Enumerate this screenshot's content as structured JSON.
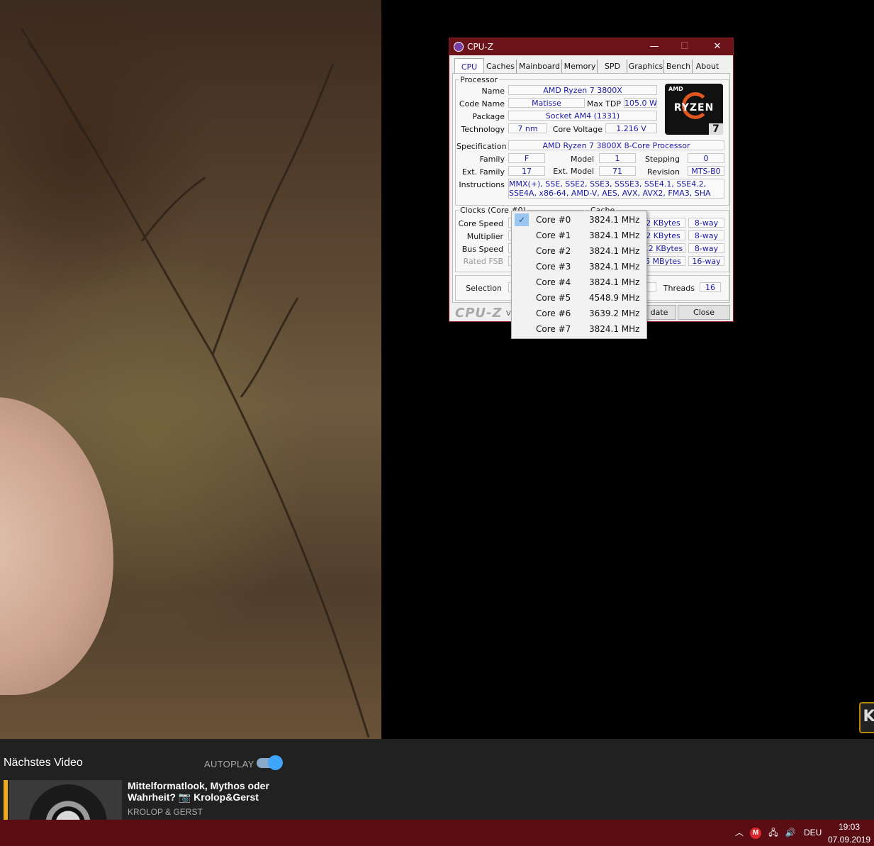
{
  "next_panel": {
    "heading": "Nächstes Video",
    "autoplay_label": "AUTOPLAY",
    "autoplay_on": true,
    "video_title": "Mittelformatlook, Mythos oder Wahrheit? 📷 Krolop&Gerst",
    "channel": "KROLOP & GERST"
  },
  "watermark_text": "K",
  "taskbar": {
    "language": "DEU",
    "time": "19:03",
    "date": "07.09.2019",
    "icons": [
      "chevron-up-icon",
      "mega-icon",
      "network-icon",
      "volume-icon"
    ]
  },
  "cpuz": {
    "title": "CPU-Z",
    "window_buttons": {
      "minimize": "—",
      "maximize": "☐",
      "close": "✕"
    },
    "tabs": [
      "CPU",
      "Caches",
      "Mainboard",
      "Memory",
      "SPD",
      "Graphics",
      "Bench",
      "About"
    ],
    "active_tab": "CPU",
    "processor": {
      "legend": "Processor",
      "name_label": "Name",
      "name": "AMD Ryzen 7 3800X",
      "code_name_label": "Code Name",
      "code_name": "Matisse",
      "max_tdp_label": "Max TDP",
      "max_tdp": "105.0 W",
      "package_label": "Package",
      "package": "Socket AM4 (1331)",
      "technology_label": "Technology",
      "technology": "7 nm",
      "core_voltage_label": "Core Voltage",
      "core_voltage": "1.216 V",
      "specification_label": "Specification",
      "specification": "AMD Ryzen 7 3800X 8-Core Processor",
      "family_label": "Family",
      "family": "F",
      "model_label": "Model",
      "model": "1",
      "stepping_label": "Stepping",
      "stepping": "0",
      "ext_family_label": "Ext. Family",
      "ext_family": "17",
      "ext_model_label": "Ext. Model",
      "ext_model": "71",
      "revision_label": "Revision",
      "revision": "MTS-B0",
      "instructions_label": "Instructions",
      "instructions": "MMX(+), SSE, SSE2, SSE3, SSSE3, SSE4.1, SSE4.2, SSE4A, x86-64, AMD-V, AES, AVX, AVX2, FMA3, SHA"
    },
    "logo": {
      "brand": "AMD",
      "series": "RYZEN",
      "tier": "7"
    },
    "clocks": {
      "legend": "Clocks (Core #0)",
      "core_speed_label": "Core Speed",
      "multiplier_label": "Multiplier",
      "bus_speed_label": "Bus Speed",
      "rated_fsb_label": "Rated FSB"
    },
    "cache": {
      "legend": "Cache",
      "rows": [
        {
          "size": "2 KBytes",
          "assoc": "8-way"
        },
        {
          "size": "2 KBytes",
          "assoc": "8-way"
        },
        {
          "size": "12 KBytes",
          "assoc": "8-way"
        },
        {
          "size": "5 MBytes",
          "assoc": "16-way"
        }
      ]
    },
    "selection_label": "Selection",
    "threads_label": "Threads",
    "threads": "16",
    "footer": {
      "brand": "CPU-Z",
      "version_prefix": "V",
      "validate_label": "date",
      "close_label": "Close"
    }
  },
  "core_dropdown": {
    "items": [
      {
        "core": "Core #0",
        "freq": "3824.1 MHz",
        "checked": true
      },
      {
        "core": "Core #1",
        "freq": "3824.1 MHz",
        "checked": false
      },
      {
        "core": "Core #2",
        "freq": "3824.1 MHz",
        "checked": false
      },
      {
        "core": "Core #3",
        "freq": "3824.1 MHz",
        "checked": false
      },
      {
        "core": "Core #4",
        "freq": "3824.1 MHz",
        "checked": false
      },
      {
        "core": "Core #5",
        "freq": "4548.9 MHz",
        "checked": false
      },
      {
        "core": "Core #6",
        "freq": "3639.2 MHz",
        "checked": false
      },
      {
        "core": "Core #7",
        "freq": "3824.1 MHz",
        "checked": false
      }
    ]
  }
}
